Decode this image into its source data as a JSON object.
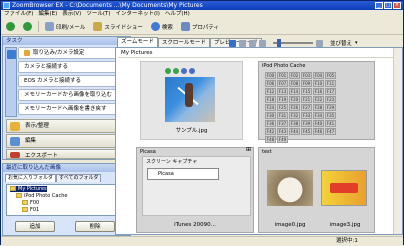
{
  "window": {
    "title": "ZoomBrowser EX - C:\\Documents ...\\My Documents\\My Pictures",
    "min": "_",
    "max": "□",
    "close": "×"
  },
  "menu": [
    "ファイル(F)",
    "編集(E)",
    "表示(V)",
    "ツール(T)",
    "インターネット(I)",
    "ヘルプ(H)"
  ],
  "toolbar": {
    "print": "印刷/メール",
    "slideshow": "スライドショー",
    "search": "検索",
    "properties": "プロパティ"
  },
  "left": {
    "header": "タスク",
    "tasks": [
      "取り込み/カメラ設定",
      "カメラと接続する",
      "EOS カメラと接続する",
      "メモリーカードから画像を取り込む",
      "メモリーカードへ画像を書き戻す"
    ],
    "categories": [
      "表示/整理",
      "編集",
      "エクスポート"
    ],
    "recent_title": "最近に取り込んだ画像",
    "tabs": [
      "お気に入りフォルダ",
      "すべてのフォルダ"
    ],
    "tree": [
      "My Pictures",
      "iPod Photo Cache",
      "F00",
      "F01"
    ],
    "btn_add": "追加",
    "btn_remove": "削除"
  },
  "view": {
    "tabs": [
      "ズームモード",
      "スクロールモード",
      "プレビューモード"
    ],
    "sort": "並び替え",
    "breadcrumb": "My Pictures"
  },
  "tiles": {
    "sample_label": "サンプル.jpg",
    "ipod_title": "iPod Photo Cache",
    "picasa_title": "Picasa",
    "picasa_sub": "スクリーン キャプチャ",
    "picasa_inner": "Picasa",
    "itunes_label": "iTunes 20090...",
    "test_title": "test",
    "img0_label": "image0.jpg",
    "img3_label": "image3.jpg"
  },
  "ipod_cells": [
    "F00",
    "F01",
    "F02",
    "F03",
    "F04",
    "F05",
    "F06",
    "F07",
    "F08",
    "F09",
    "F10",
    "F11",
    "F12",
    "F13",
    "F14",
    "F15",
    "F16",
    "F17",
    "F18",
    "F19",
    "F20",
    "F21",
    "F22",
    "F23",
    "F24",
    "F25",
    "F26",
    "F27",
    "F28",
    "F29",
    "F30",
    "F31",
    "F32",
    "F33",
    "F34",
    "F35",
    "F36",
    "F37",
    "F38",
    "F39",
    "F40",
    "F41",
    "F42",
    "F43",
    "F44",
    "F45",
    "F46",
    "F47",
    "F48",
    "F49"
  ],
  "status": {
    "right": "選択中:1"
  }
}
